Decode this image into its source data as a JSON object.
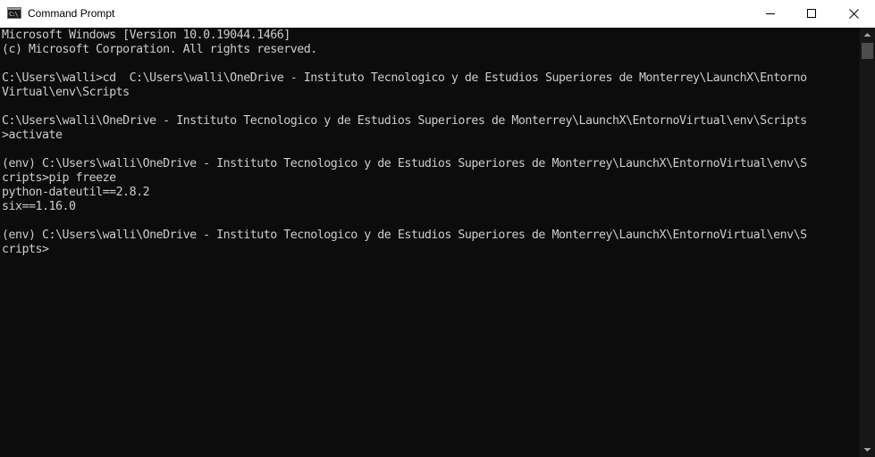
{
  "window": {
    "title": "Command Prompt",
    "icon": "cmd-icon",
    "icon_glyph": "C:\\"
  },
  "controls": {
    "minimize_icon": "minimize-icon",
    "maximize_icon": "maximize-icon",
    "close_icon": "close-icon"
  },
  "console": {
    "lines": [
      "Microsoft Windows [Version 10.0.19044.1466]",
      "(c) Microsoft Corporation. All rights reserved.",
      "",
      "C:\\Users\\walli>cd  C:\\Users\\walli\\OneDrive - Instituto Tecnologico y de Estudios Superiores de Monterrey\\LaunchX\\Entorno",
      "Virtual\\env\\Scripts",
      "",
      "C:\\Users\\walli\\OneDrive - Instituto Tecnologico y de Estudios Superiores de Monterrey\\LaunchX\\EntornoVirtual\\env\\Scripts",
      ">activate",
      "",
      "(env) C:\\Users\\walli\\OneDrive - Instituto Tecnologico y de Estudios Superiores de Monterrey\\LaunchX\\EntornoVirtual\\env\\S",
      "cripts>pip freeze",
      "python-dateutil==2.8.2",
      "six==1.16.0",
      "",
      "(env) C:\\Users\\walli\\OneDrive - Instituto Tecnologico y de Estudios Superiores de Monterrey\\LaunchX\\EntornoVirtual\\env\\S",
      "cripts>"
    ]
  },
  "colors": {
    "console_bg": "#0c0c0c",
    "console_text": "#cccccc",
    "titlebar_bg": "#ffffff"
  }
}
